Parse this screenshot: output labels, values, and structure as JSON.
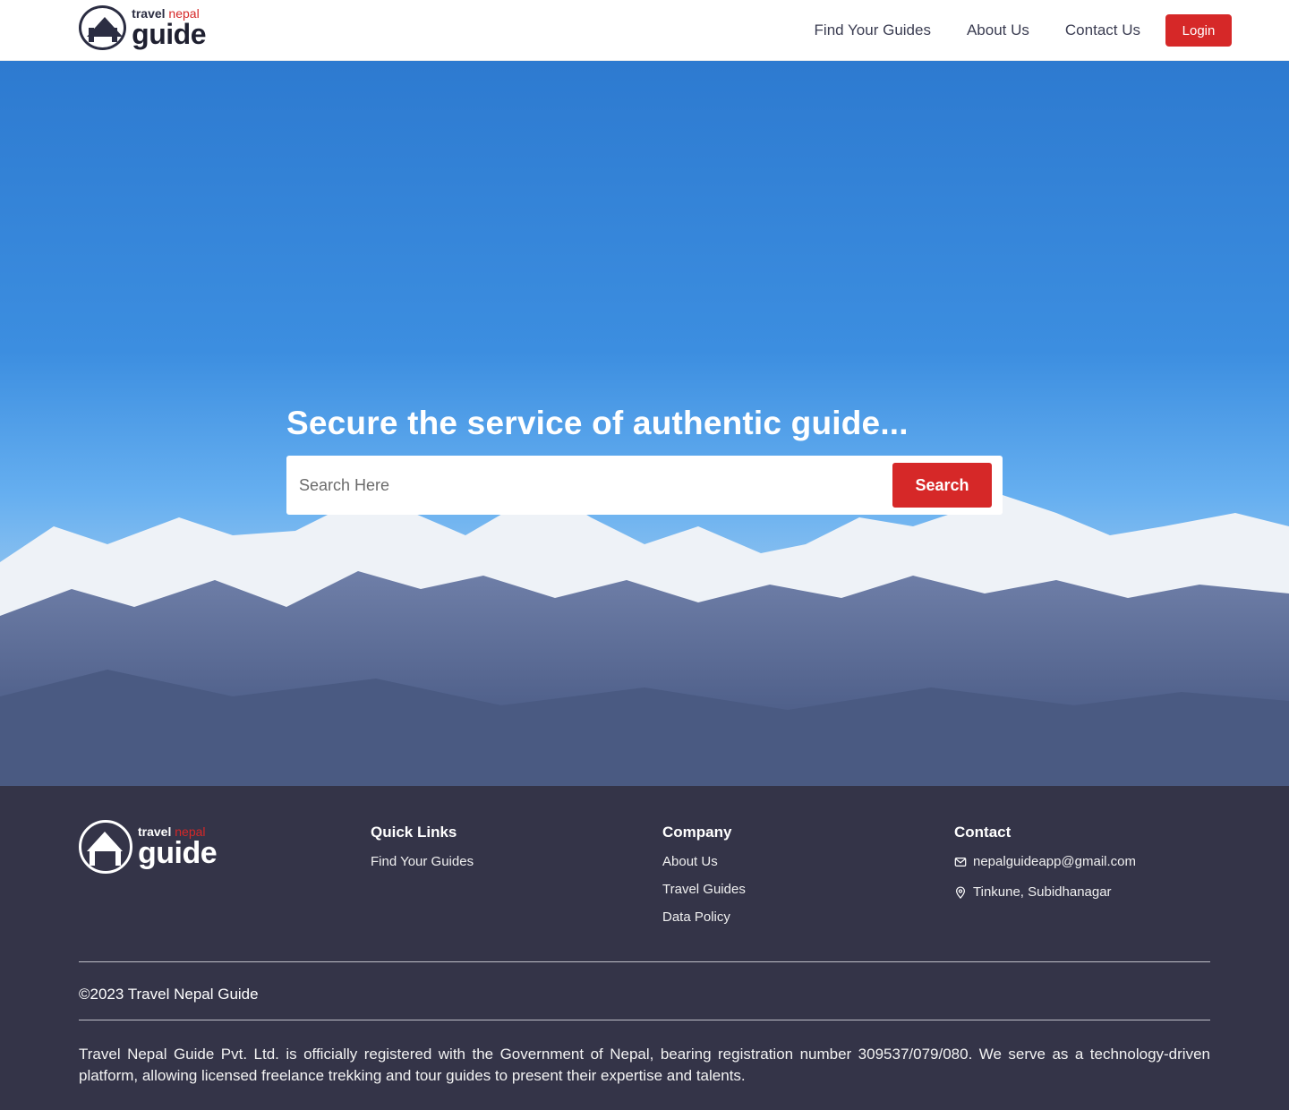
{
  "header": {
    "logo": {
      "top": "travel",
      "top_accent": "nepal",
      "main": "guide"
    },
    "nav": [
      "Find Your Guides",
      "About Us",
      "Contact Us"
    ],
    "login_label": "Login"
  },
  "hero": {
    "title": "Secure the service of authentic guide...",
    "search_placeholder": "Search Here",
    "search_label": "Search"
  },
  "footer": {
    "logo": {
      "top": "travel",
      "top_accent": "nepal",
      "main": "guide"
    },
    "quick_links": {
      "heading": "Quick Links",
      "items": [
        "Find Your Guides"
      ]
    },
    "company": {
      "heading": "Company",
      "items": [
        "About Us",
        "Travel Guides",
        "Data Policy"
      ]
    },
    "contact": {
      "heading": "Contact",
      "email": "nepalguideapp@gmail.com",
      "address": "Tinkune, Subidhanagar"
    },
    "copyright": "©2023 Travel Nepal Guide",
    "legal": "Travel Nepal Guide Pvt. Ltd. is officially registered with the Government of Nepal, bearing registration number 309537/079/080. We serve as a technology-driven platform, allowing licensed freelance trekking and tour guides to present their expertise and talents."
  },
  "colors": {
    "accent": "#d62828",
    "footer_bg": "#343448",
    "sky": "#2d7ad0"
  },
  "icons": [
    "mail-icon",
    "location-pin-icon"
  ]
}
